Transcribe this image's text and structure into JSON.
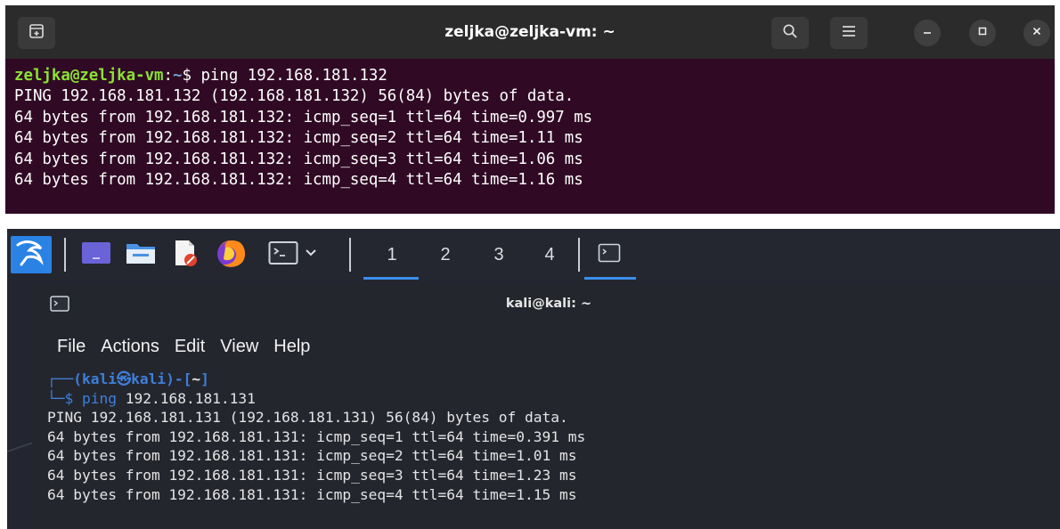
{
  "ubuntu_terminal": {
    "title": "zeljka@zeljka-vm: ~",
    "prompt_user": "zeljka@zeljka-vm",
    "prompt_colon": ":",
    "prompt_path": "~",
    "prompt_symbol": "$ ",
    "command": "ping 192.168.181.132",
    "output": [
      "PING 192.168.181.132 (192.168.181.132) 56(84) bytes of data.",
      "64 bytes from 192.168.181.132: icmp_seq=1 ttl=64 time=0.997 ms",
      "64 bytes from 192.168.181.132: icmp_seq=2 ttl=64 time=1.11 ms",
      "64 bytes from 192.168.181.132: icmp_seq=3 ttl=64 time=1.06 ms",
      "64 bytes from 192.168.181.132: icmp_seq=4 ttl=64 time=1.16 ms"
    ],
    "colors": {
      "background": "#300a24",
      "header": "#2b2b2b",
      "user": "#8ae234",
      "path": "#729fcf"
    },
    "icons": [
      "new-tab-icon",
      "search-icon",
      "hamburger-menu-icon",
      "minimize-icon",
      "maximize-icon",
      "close-icon"
    ]
  },
  "kali": {
    "taskbar": {
      "workspaces": [
        "1",
        "2",
        "3",
        "4"
      ],
      "active_workspace": "1",
      "icons": [
        "kali-dragon-icon",
        "desktop-icon",
        "file-manager-icon",
        "text-editor-icon",
        "firefox-icon",
        "terminal-icon",
        "dropdown-chevron-icon",
        "terminal-window-icon"
      ]
    },
    "terminal": {
      "title": "kali@kali: ~",
      "menu": [
        "File",
        "Actions",
        "Edit",
        "View",
        "Help"
      ],
      "prompt_line1_box": "┌──",
      "prompt_open": "(",
      "prompt_user": "kali",
      "prompt_skull": "㉿",
      "prompt_host": "kali",
      "prompt_close": ")-[",
      "prompt_path": "~",
      "prompt_end": "]",
      "prompt_line2_box": "└─",
      "prompt_symbol": "$ ",
      "command_name": "ping",
      "command_arg": " 192.168.181.131",
      "output": [
        "PING 192.168.181.131 (192.168.181.131) 56(84) bytes of data.",
        "64 bytes from 192.168.181.131: icmp_seq=1 ttl=64 time=0.391 ms",
        "64 bytes from 192.168.181.131: icmp_seq=2 ttl=64 time=1.01 ms",
        "64 bytes from 192.168.181.131: icmp_seq=3 ttl=64 time=1.23 ms",
        "64 bytes from 192.168.181.131: icmp_seq=4 ttl=64 time=1.15 ms"
      ],
      "colors": {
        "background": "#24262e",
        "prompt": "#3f7fd9",
        "text": "#e4e4e4"
      }
    }
  }
}
